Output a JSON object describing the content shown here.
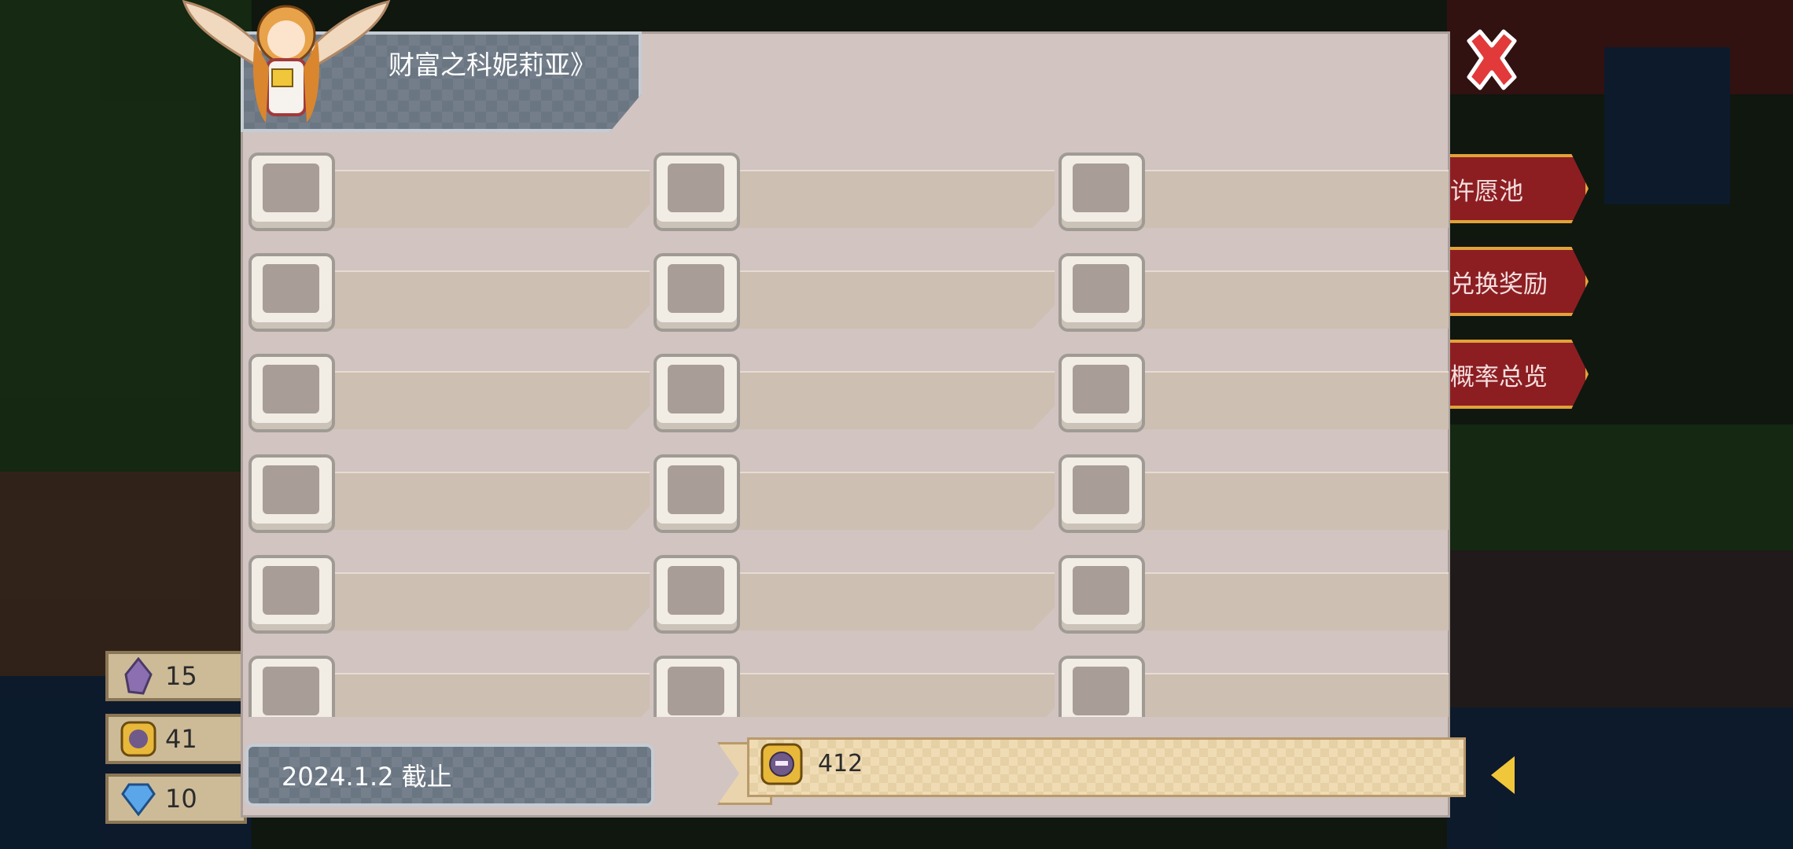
{
  "panel": {
    "title": "财富之科妮莉亚》",
    "deadline": "2024.1.2 截止",
    "currency_count": "412",
    "slot_rows": 6,
    "slot_cols": 3
  },
  "side_menu": [
    {
      "label": "许愿池"
    },
    {
      "label": "兑换奖励"
    },
    {
      "label": "概率总览"
    }
  ],
  "resources": [
    {
      "icon": "crystal-icon",
      "value": "15"
    },
    {
      "icon": "coin-icon",
      "value": "41"
    },
    {
      "icon": "diamond-icon",
      "value": "10"
    }
  ],
  "colors": {
    "panel_bg": "#d1c4c1",
    "title_plate": "#6b7683",
    "close_red": "#e23a3a",
    "ribbon": "#f0dcb4",
    "side_btn": "#8c1e22"
  }
}
